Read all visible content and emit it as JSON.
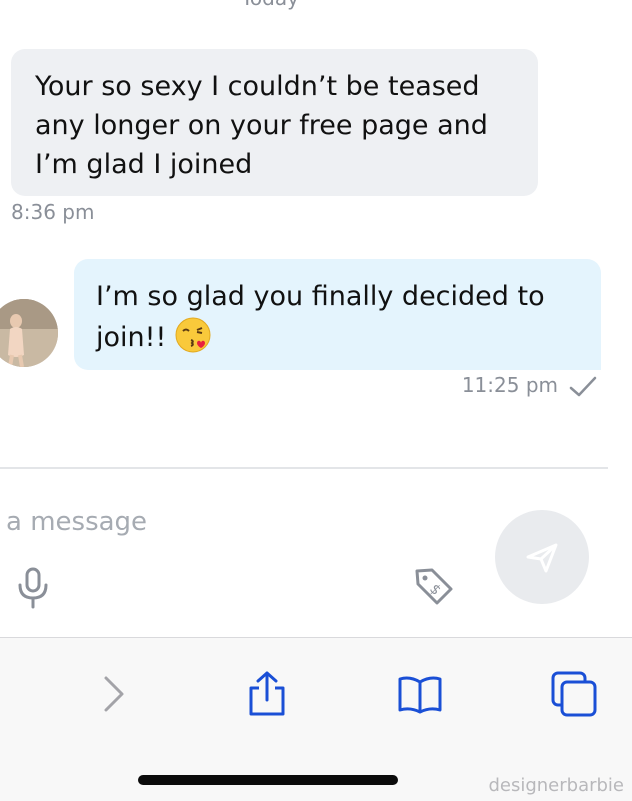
{
  "day_label": "Today",
  "messages": [
    {
      "direction": "incoming",
      "lines": [
        "Your so sexy I couldn’t be teased",
        "any longer on your free page and",
        "I’m glad I joined"
      ],
      "time": "8:36 pm"
    },
    {
      "direction": "outgoing",
      "lines": [
        "I’m so glad you finally decided to",
        "join!!"
      ],
      "emoji": "😘",
      "time": "11:25 pm",
      "status_icon": "check-icon"
    }
  ],
  "composer": {
    "placeholder": "a message",
    "icons": [
      "microphone-icon",
      "price-tag-icon",
      "send-icon"
    ]
  },
  "toolbar": {
    "icons": [
      "forward-icon",
      "share-icon",
      "bookmarks-icon",
      "tabs-icon"
    ]
  },
  "watermark": "designerbarbie",
  "colors": {
    "incoming_bubble": "#eef0f3",
    "outgoing_bubble": "#e4f4fd",
    "toolbar_accent": "#1a4fd6",
    "meta_text": "#8a8f98"
  }
}
